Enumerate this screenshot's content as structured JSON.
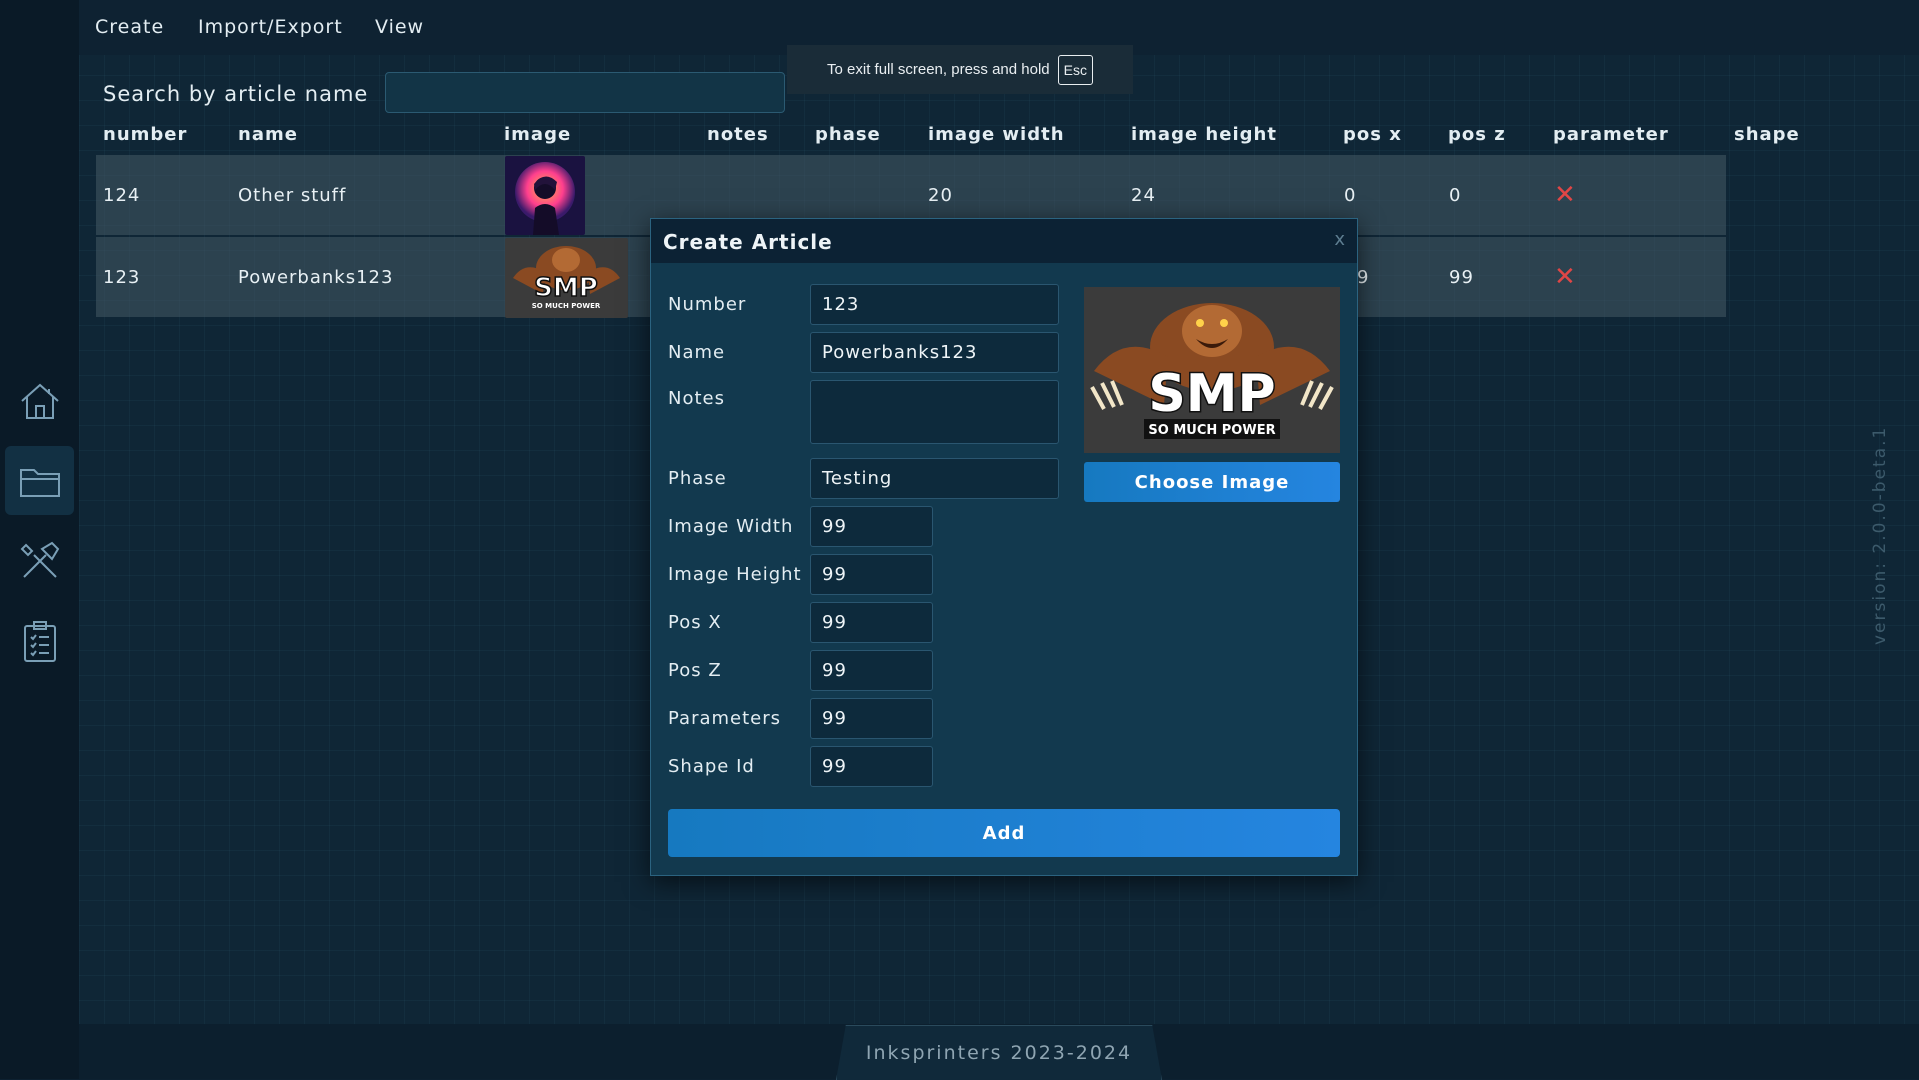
{
  "menu": {
    "create": "Create",
    "import_export": "Import/Export",
    "view": "View"
  },
  "fullscreen_notice": {
    "text": "To exit full screen, press and hold",
    "key": "Esc"
  },
  "search": {
    "label": "Search by article name",
    "value": ""
  },
  "table": {
    "headers": {
      "number": "number",
      "name": "name",
      "image": "image",
      "notes": "notes",
      "phase": "phase",
      "image_width": "image width",
      "image_height": "image height",
      "pos_x": "pos x",
      "pos_z": "pos z",
      "parameter": "parameter",
      "shape": "shape"
    },
    "rows": [
      {
        "number": "124",
        "name": "Other stuff",
        "image_width": "20",
        "image_height": "24",
        "pos_x": "0",
        "pos_z": "0",
        "parameter": "✕"
      },
      {
        "number": "123",
        "name": "Powerbanks123",
        "pos_x": "9",
        "pos_z": "99",
        "parameter": "✕"
      }
    ]
  },
  "modal": {
    "title": "Create Article",
    "close": "x",
    "fields": {
      "number": {
        "label": "Number",
        "value": "123"
      },
      "name": {
        "label": "Name",
        "value": "Powerbanks123"
      },
      "notes": {
        "label": "Notes",
        "value": ""
      },
      "phase": {
        "label": "Phase",
        "value": "Testing"
      },
      "image_width": {
        "label": "Image Width",
        "value": "99"
      },
      "image_height": {
        "label": "Image Height",
        "value": "99"
      },
      "pos_x": {
        "label": "Pos X",
        "value": "99"
      },
      "pos_z": {
        "label": "Pos Z",
        "value": "99"
      },
      "parameters": {
        "label": "Parameters",
        "value": "99"
      },
      "shape_id": {
        "label": "Shape Id",
        "value": "99"
      }
    },
    "preview_logo": {
      "main": "SMP",
      "sub": "SO MUCH POWER"
    },
    "choose_image": "Choose Image",
    "add": "Add"
  },
  "version": "version: 2.0.0-beta.1",
  "footer": "Inksprinters 2023-2024",
  "icons": {
    "home": "home-icon",
    "folder": "folder-icon",
    "tools": "tools-icon",
    "clipboard": "clipboard-icon"
  },
  "colors": {
    "accent": "#1f80d6",
    "danger": "#e04646",
    "background": "#0f2636"
  }
}
